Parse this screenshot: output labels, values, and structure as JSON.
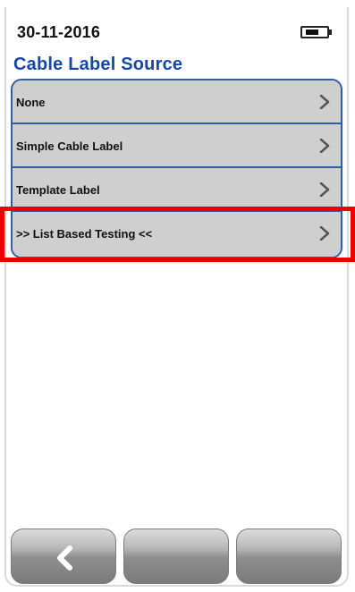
{
  "status_bar": {
    "date": "30-11-2016",
    "battery_icon": "battery-icon"
  },
  "screen": {
    "title": "Cable Label Source"
  },
  "menu": {
    "items": [
      {
        "label": "None",
        "icon": "chevron-right-icon"
      },
      {
        "label": "Simple Cable Label",
        "icon": "chevron-right-icon"
      },
      {
        "label": "Template Label",
        "icon": "chevron-right-icon"
      },
      {
        "label": ">> List Based Testing <<",
        "icon": "chevron-right-icon",
        "highlighted": true
      }
    ]
  },
  "bottom_bar": {
    "softkeys": [
      {
        "label": "",
        "icon": "back-icon"
      },
      {
        "label": ""
      },
      {
        "label": ""
      }
    ]
  },
  "colors": {
    "title_text": "#1747a6",
    "menu_background": "#cfcfcf",
    "menu_border": "#2f5ea8",
    "highlight": "#ef0000",
    "softkey_gradient_top": "#dcdcdc",
    "softkey_gradient_bottom": "#7a7a7a"
  }
}
